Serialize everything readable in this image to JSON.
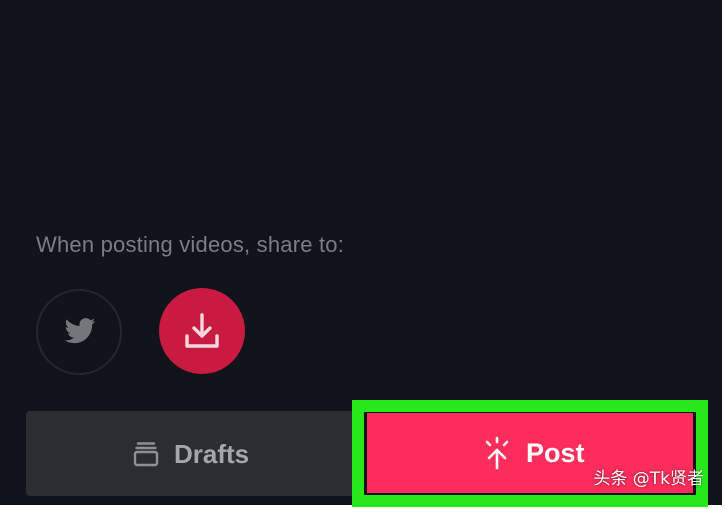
{
  "share": {
    "label": "When posting videos, share to:",
    "targets": [
      {
        "name": "Twitter",
        "icon": "twitter-bird-icon"
      },
      {
        "name": "Save to device",
        "icon": "download-icon"
      }
    ]
  },
  "actions": {
    "drafts_label": "Drafts",
    "drafts_icon": "drafts-stack-icon",
    "post_label": "Post",
    "post_icon": "post-upload-icon"
  },
  "watermark": "头条 @Tk贤者",
  "colors": {
    "background": "#11131b",
    "save_circle": "#c91a42",
    "drafts_button": "#2b2d33",
    "post_button": "#fc2d5b",
    "highlight_box": "#27e81b",
    "label_text": "#7b7d84"
  }
}
